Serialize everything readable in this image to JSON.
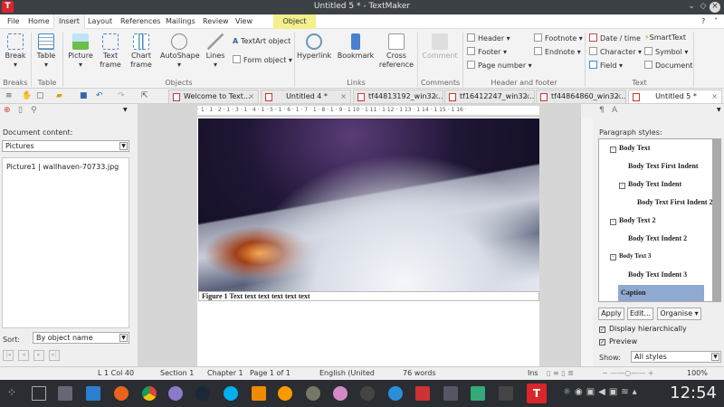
{
  "window": {
    "title": "Untitled 5 * - TextMaker",
    "app_logo": "T"
  },
  "menu": {
    "tabs": [
      "File",
      "Home",
      "Insert",
      "Layout",
      "References",
      "Mailings",
      "Review",
      "View",
      "Object"
    ],
    "active": "Insert",
    "help": "?"
  },
  "ribbon": {
    "break": "Break",
    "table": "Table",
    "picture": "Picture",
    "text_frame": "Text frame",
    "chart_frame": "Chart frame",
    "autoshape": "AutoShape",
    "lines": "Lines",
    "textart": "TextArt object",
    "form_object": "Form object",
    "hyperlink": "Hyperlink",
    "bookmark": "Bookmark",
    "cross_reference": "Cross reference",
    "comment": "Comment",
    "header": "Header",
    "footer": "Footer",
    "page_number": "Page number",
    "footnote": "Footnote",
    "endnote": "Endnote",
    "date_time": "Date / time",
    "character": "Character",
    "field": "Field",
    "smarttext": "SmartText",
    "symbol": "Symbol",
    "document": "Document",
    "groups": [
      "Breaks",
      "Table",
      "Objects",
      "Links",
      "Comments",
      "Header and footer",
      "Text"
    ]
  },
  "doc_tabs": [
    {
      "label": "Welcome to Text..."
    },
    {
      "label": "Untitled 4 *"
    },
    {
      "label": "tf44813192_win32..."
    },
    {
      "label": "tf16412247_win32..."
    },
    {
      "label": "tf44864860_win32..."
    },
    {
      "label": "Untitled 5 *",
      "active": true
    }
  ],
  "ruler": "· 1 · 1 · 2 · 1 · 3 · 1 · 4 · 1 · 5 · 1 · 6 · 1 · 7 · 1 · 8 · 1 · 9 · 1 10 · 1 11 · 1 12 · 1 13 · 1 14 · 1 15 · 1 16 ·",
  "left_panel": {
    "heading": "Document content:",
    "filter": "Pictures",
    "items": [
      "Picture1 | wallhaven-70733.jpg"
    ],
    "sort_label": "Sort:",
    "sort_value": "By object name"
  },
  "document": {
    "caption": "Figure 1 Text text text text text text"
  },
  "right_panel": {
    "heading": "Paragraph styles:",
    "styles": [
      {
        "name": "Body Text",
        "level": 0
      },
      {
        "name": "Body Text First Indent",
        "level": 1
      },
      {
        "name": "Body Text Indent",
        "level": 1
      },
      {
        "name": "Body Text First Indent 2",
        "level": 2
      },
      {
        "name": "Body Text 2",
        "level": 0
      },
      {
        "name": "Body Text Indent 2",
        "level": 1
      },
      {
        "name": "Body Text 3",
        "level": 0
      },
      {
        "name": "Body Text Indent 3",
        "level": 1
      },
      {
        "name": "Caption",
        "level": 0,
        "selected": true
      }
    ],
    "apply": "Apply",
    "edit": "Edit...",
    "organise": "Organise",
    "display_hierarchically": "Display hierarchically",
    "display_hierarchically_checked": true,
    "preview": "Preview",
    "preview_checked": true,
    "show_label": "Show:",
    "show_value": "All styles"
  },
  "status": {
    "position": "L 1 Col 40",
    "section": "Section 1",
    "chapter": "Chapter 1",
    "page": "Page 1 of 1",
    "language": "English (United",
    "words": "76 words",
    "mode": "Ins",
    "zoom": "100%"
  },
  "taskbar": {
    "clock": "12:54"
  },
  "colors": {
    "accent": "#d8262b",
    "object_tab": "#f2ef8c",
    "selected_style": "#8fa9d1"
  }
}
